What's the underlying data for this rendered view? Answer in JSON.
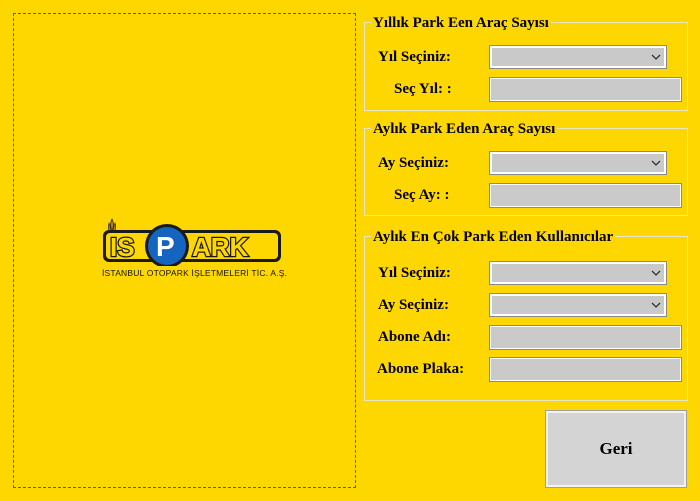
{
  "logo": {
    "brand": "İSPARK",
    "subtitle": "İSTANBUL OTOPARK İŞLETMELERİ TİC. A.Ş."
  },
  "yearly_group": {
    "title": "Yıllık Park Een Araç Sayısı",
    "year_label": "Yıl Seçiniz:",
    "year_value": "",
    "result_label": "Seç Yıl: :",
    "result_value": ""
  },
  "monthly_group": {
    "title": "Aylık Park Eden Araç Sayısı",
    "month_label": "Ay Seçiniz:",
    "month_value": "",
    "result_label": "Seç Ay:  :",
    "result_value": ""
  },
  "top_users_group": {
    "title": "Aylık En Çok Park Eden Kullanıcılar",
    "year_label": "Yıl Seçiniz:",
    "year_value": "",
    "month_label": "Ay Seçiniz:",
    "month_value": "",
    "subscriber_name_label": "Abone Adı:",
    "subscriber_name_value": "",
    "subscriber_plate_label": "Abone Plaka:",
    "subscriber_plate_value": ""
  },
  "buttons": {
    "back_label": "Geri"
  },
  "colors": {
    "background": "#FFD700",
    "input_fill": "#C9C9C9",
    "logo_blue": "#1565C0"
  },
  "icons": {
    "combo_arrow": "chevron-down-icon"
  }
}
